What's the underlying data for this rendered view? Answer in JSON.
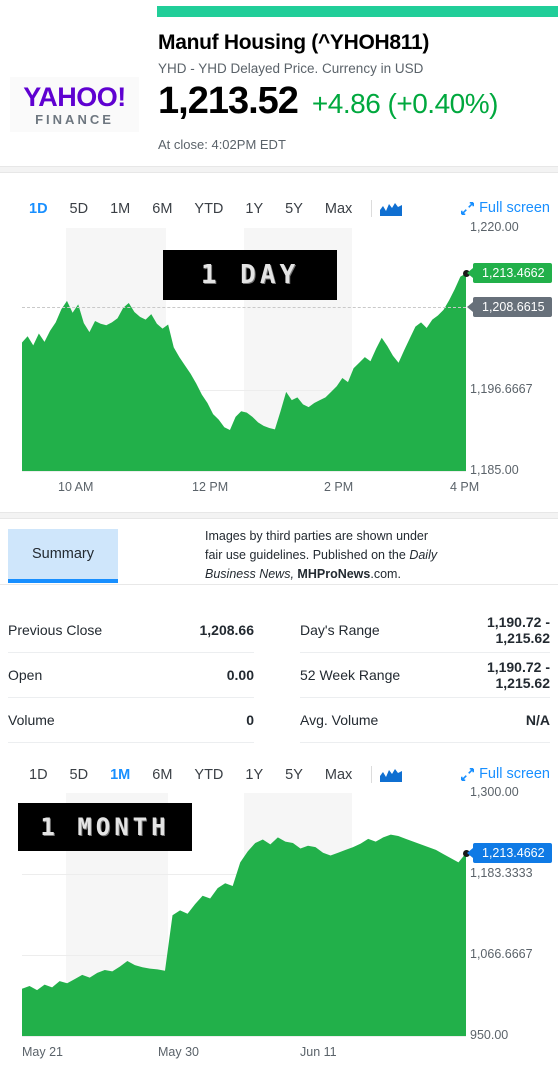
{
  "brand": {
    "word": "YAHOO!",
    "sub": "FINANCE",
    "accent": "#5f01d1",
    "bar_color": "#21ce99"
  },
  "header": {
    "title": "Manuf Housing (^YHOH811)",
    "subtitle": "YHD - YHD Delayed Price. Currency in USD",
    "price": "1,213.52",
    "change": "+4.86 (+0.40%)",
    "change_color": "#00a83e",
    "close_note": "At close: 4:02PM EDT"
  },
  "ranges": [
    "1D",
    "5D",
    "1M",
    "6M",
    "YTD",
    "1Y",
    "5Y",
    "Max"
  ],
  "chart_toolbar": {
    "chart_type_icon": "area-chart-icon",
    "fullscreen_icon": "expand-arrows-icon",
    "fullscreen_label": "Full screen"
  },
  "summary": {
    "tab_label": "Summary",
    "notice_line1": "Images by third parties are shown under",
    "notice_line2a": "fair use guidelines.  Published on the ",
    "notice_italic1": "Daily",
    "notice_italic2": "Business News,",
    "notice_bold": "MHProNews",
    "notice_tail": ".com."
  },
  "stats": {
    "left": [
      {
        "label": "Previous Close",
        "value": "1,208.66"
      },
      {
        "label": "Open",
        "value": "0.00"
      },
      {
        "label": "Volume",
        "value": "0"
      }
    ],
    "right": [
      {
        "label": "Day's Range",
        "value": "1,190.72 -\n1,215.62"
      },
      {
        "label": "52 Week Range",
        "value": "1,190.72 -\n1,215.62"
      },
      {
        "label": "Avg. Volume",
        "value": "N/A"
      }
    ]
  },
  "chart_data": [
    {
      "id": "chart-1d",
      "type": "area",
      "title": "1 DAY",
      "active_range": "1D",
      "watermark": "1 DAY",
      "ylabel": "",
      "xlabel": "",
      "ylim": [
        1185.0,
        1220.0
      ],
      "ytick_labels": [
        "1,220.00",
        "1,196.6667",
        "1,185.00"
      ],
      "ytick_values": [
        1220.0,
        1196.6667,
        1185.0
      ],
      "xtick_labels": [
        "10 AM",
        "12 PM",
        "2 PM",
        "4 PM"
      ],
      "grid": true,
      "last_price_badge": "1,213.4662",
      "last_price_value": 1213.4662,
      "prev_close_badge": "1,208.6615",
      "prev_close_value": 1208.6615,
      "series_color": "#22b04a",
      "x": [
        0,
        1,
        2,
        3,
        4,
        5,
        6,
        7,
        8,
        9,
        10,
        11,
        12,
        13,
        14,
        15,
        16,
        17,
        18,
        19,
        20,
        21,
        22,
        23,
        24,
        25,
        26,
        27,
        28,
        29,
        30,
        31,
        32,
        33,
        34,
        35,
        36,
        37,
        38,
        39,
        40,
        41,
        42,
        43,
        44,
        45,
        46,
        47,
        48,
        49,
        50,
        51,
        52,
        53,
        54,
        55,
        56,
        57,
        58,
        59,
        60,
        61,
        62,
        63,
        64,
        65,
        66,
        67,
        68,
        69,
        70,
        71,
        72,
        73,
        74,
        75,
        76,
        77,
        78,
        79
      ],
      "values": [
        1203.5,
        1204.4,
        1203.1,
        1204.8,
        1203.6,
        1205.2,
        1206.4,
        1208.3,
        1209.5,
        1207.8,
        1209.0,
        1206.3,
        1205.0,
        1206.6,
        1206.2,
        1206.0,
        1206.4,
        1207.0,
        1208.5,
        1209.2,
        1207.9,
        1207.2,
        1206.8,
        1207.6,
        1206.2,
        1205.5,
        1206.1,
        1202.8,
        1201.4,
        1200.2,
        1199.0,
        1197.6,
        1196.0,
        1194.8,
        1193.2,
        1192.4,
        1191.3,
        1190.9,
        1192.8,
        1193.6,
        1193.4,
        1192.8,
        1192.0,
        1191.5,
        1191.2,
        1191.0,
        1193.6,
        1196.4,
        1195.2,
        1195.6,
        1194.6,
        1194.2,
        1194.8,
        1195.2,
        1195.6,
        1196.4,
        1197.2,
        1198.4,
        1197.8,
        1199.8,
        1200.6,
        1201.4,
        1200.8,
        1202.6,
        1204.2,
        1203.0,
        1201.6,
        1200.6,
        1202.4,
        1204.1,
        1205.8,
        1206.4,
        1205.6,
        1206.8,
        1207.4,
        1208.2,
        1209.6,
        1211.2,
        1213.0,
        1213.4662
      ]
    },
    {
      "id": "chart-1m",
      "type": "area",
      "title": "1 MONTH",
      "active_range": "1M",
      "watermark": "1 MONTH",
      "ylabel": "",
      "xlabel": "",
      "ylim": [
        950.0,
        1300.0
      ],
      "ytick_labels": [
        "1,300.00",
        "1,183.3333",
        "1,066.6667",
        "950.00"
      ],
      "ytick_values": [
        1300.0,
        1183.3333,
        1066.6667,
        950.0
      ],
      "xtick_labels": [
        "May 21",
        "May 30",
        "Jun 11"
      ],
      "grid": true,
      "last_price_badge": "1,213.4662",
      "last_price_value": 1213.4662,
      "series_color": "#22b04a",
      "x": [
        0,
        1,
        2,
        3,
        4,
        5,
        6,
        7,
        8,
        9,
        10,
        11,
        12,
        13,
        14,
        15,
        16,
        17,
        18,
        19,
        20,
        21,
        22,
        23,
        24,
        25,
        26,
        27,
        28,
        29,
        30,
        31,
        32,
        33,
        34,
        35,
        36,
        37,
        38,
        39,
        40,
        41,
        42,
        43,
        44,
        45,
        46,
        47,
        48,
        49,
        50,
        51,
        52,
        53,
        54,
        55,
        56,
        57,
        58,
        59
      ],
      "values": [
        1018.0,
        1022.0,
        1016.0,
        1024.0,
        1020.0,
        1029.0,
        1026.0,
        1032.0,
        1038.0,
        1034.0,
        1041.0,
        1045.0,
        1043.0,
        1050.0,
        1058.0,
        1052.0,
        1049.0,
        1047.0,
        1046.0,
        1044.0,
        1124.0,
        1131.0,
        1126.0,
        1140.0,
        1152.0,
        1148.0,
        1163.0,
        1170.0,
        1166.0,
        1200.0,
        1216.0,
        1228.0,
        1233.0,
        1226.0,
        1236.0,
        1230.0,
        1228.0,
        1220.0,
        1224.0,
        1222.0,
        1214.0,
        1210.0,
        1214.0,
        1218.0,
        1222.0,
        1227.0,
        1234.0,
        1230.0,
        1236.0,
        1240.0,
        1238.0,
        1234.0,
        1230.0,
        1226.0,
        1222.0,
        1218.0,
        1212.0,
        1206.0,
        1200.0,
        1213.4662
      ]
    }
  ]
}
